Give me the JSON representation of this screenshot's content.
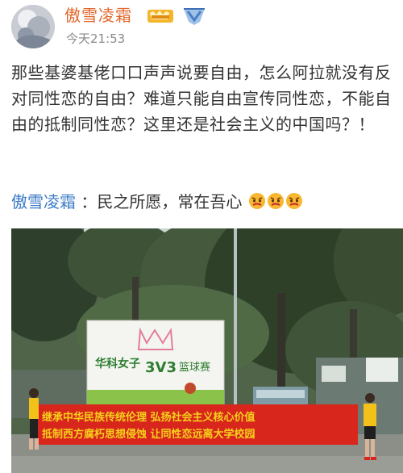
{
  "post": {
    "username": "傲雪凌霜",
    "timestamp": "今天21:53",
    "text": "那些基婆基佬口口声声说要自由，怎么阿拉就没有反对同性恋的自由？难道只能自由宣传同性恋，不能自由的抵制同性恋？这里还是社会主义的中国吗？！",
    "repost_user": "傲雪凌霜",
    "repost_text": "：民之所愿，常在吾心"
  },
  "photo": {
    "sign_title": "华科女子",
    "sign_3v3": "3V3",
    "sign_event": "篮球赛",
    "banner_line1": "继承中华民族传统伦理  弘扬社会主义核心价值",
    "banner_line2": "抵制西方腐朽思想侵蚀  让同性恋远离大学校园"
  },
  "colors": {
    "username": "#e1672a",
    "repost_user": "#3c7bc6",
    "banner": "#d9261c",
    "banner_text": "#f4d11a"
  }
}
